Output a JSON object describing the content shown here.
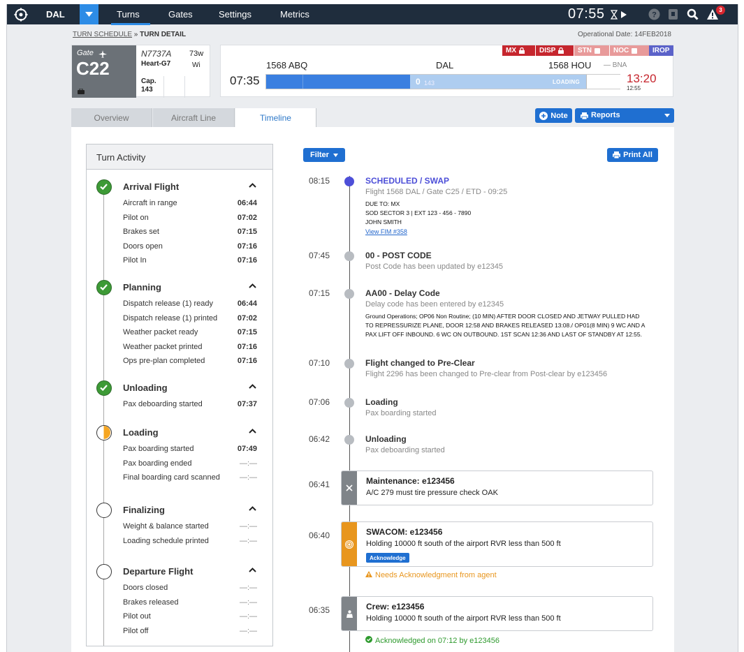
{
  "topbar": {
    "station": "DAL",
    "nav": [
      "Turns",
      "Gates",
      "Settings",
      "Metrics"
    ],
    "clock": "07:55",
    "alert_count": "3"
  },
  "breadcrumb": {
    "parent": "TURN SCHEDULE",
    "separator": " » ",
    "current": "TURN DETAIL"
  },
  "operational_date": "Operational Date: 14FEB2018",
  "gate": {
    "label": "Gate",
    "number": "C22",
    "tail": "N7737A",
    "aircraft": "Heart-G7",
    "code": "73w",
    "wi": "Wi",
    "cap_label": "Cap.",
    "cap_value": "143"
  },
  "flight": {
    "tags": [
      {
        "label": "MX",
        "color": "#c6262e"
      },
      {
        "label": "DISP",
        "color": "#c6262e"
      },
      {
        "label": "STN",
        "color": "#e89a9a"
      },
      {
        "label": "NOC",
        "color": "#e89a9a"
      },
      {
        "label": "IROP",
        "color": "#5b62c9"
      }
    ],
    "arrival": "1568 ABQ",
    "station": "DAL",
    "departure": "1568 HOU",
    "departure_alt": "— BNA",
    "arrival_time": "07:35",
    "departure_time": "13:20",
    "departure_time_small": "12:55",
    "boarded": "0",
    "capacity": "143",
    "status": "LOADING"
  },
  "tabs": [
    {
      "label": "Overview",
      "active": false
    },
    {
      "label": "Aircraft Line",
      "active": false
    },
    {
      "label": "Timeline",
      "active": true
    }
  ],
  "buttons": {
    "note": "Note",
    "reports": "Reports",
    "filter": "Filter",
    "print": "Print All"
  },
  "activity": {
    "title": "Turn Activity",
    "sections": [
      {
        "title": "Arrival Flight",
        "status": "done",
        "items": [
          {
            "label": "Aircraft in range",
            "value": "06:44"
          },
          {
            "label": "Pilot on",
            "value": "07:02"
          },
          {
            "label": "Brakes set",
            "value": "07:15"
          },
          {
            "label": "Doors open",
            "value": "07:16"
          },
          {
            "label": "Pilot In",
            "value": "07:16"
          }
        ]
      },
      {
        "title": "Planning",
        "status": "done",
        "items": [
          {
            "label": "Dispatch release (1) ready",
            "value": "06:44"
          },
          {
            "label": "Dispatch release (1) printed",
            "value": "07:02"
          },
          {
            "label": "Weather packet ready",
            "value": "07:15"
          },
          {
            "label": "Weather packet printed",
            "value": "07:16"
          },
          {
            "label": "Ops pre-plan completed",
            "value": "07:16"
          }
        ]
      },
      {
        "title": "Unloading",
        "status": "done",
        "items": [
          {
            "label": "Pax deboarding started",
            "value": "07:37"
          }
        ]
      },
      {
        "title": "Loading",
        "status": "partial",
        "items": [
          {
            "label": "Pax boarding started",
            "value": "07:49"
          },
          {
            "label": "Pax boarding ended",
            "value": "—:—"
          },
          {
            "label": "Final boarding card scanned",
            "value": "—:—"
          }
        ]
      },
      {
        "title": "Finalizing",
        "status": "pending",
        "items": [
          {
            "label": "Weight & balance started",
            "value": "—:—"
          },
          {
            "label": "Loading schedule printed",
            "value": "—:—"
          }
        ]
      },
      {
        "title": "Departure Flight",
        "status": "pending",
        "items": [
          {
            "label": "Doors closed",
            "value": "—:—"
          },
          {
            "label": "Brakes released",
            "value": "—:—"
          },
          {
            "label": "Pilot out",
            "value": "—:—"
          },
          {
            "label": "Pilot off",
            "value": "—:—"
          }
        ]
      }
    ]
  },
  "timeline": [
    {
      "time": "08:15",
      "title": "SCHEDULED / SWAP",
      "sub": "Flight 1568 DAL / Gate C25 / ETD - 09:25",
      "detail": [
        "DUE TO: MX",
        "SOD SECTOR 3 | EXT 123 - 456 - 7890",
        "JOHN SMITH"
      ],
      "link": "View FIM #358"
    },
    {
      "time": "07:45",
      "title": "00 - POST CODE",
      "sub": "Post Code has been updated by e12345"
    },
    {
      "time": "07:15",
      "title": "AA00 - Delay Code",
      "sub": "Delay code has been entered by e12345",
      "detail": [
        "Ground Operations; OP06 Non Routine; (10 MIN) AFTER DOOR CLOSED AND JETWAY PULLED HAD",
        "TO REPRESSURIZE PLANE, DOOR 12:58 AND BRAKES RELEASED 13:08./ OP01(8 MIN) 9 WC AND A",
        "PAX LIFT OFF INBOUND. 6 WC ON OUTBOUND. 1ST SCAN 12:36 AND LAST OF STANDBY AT 12:55."
      ]
    },
    {
      "time": "07:10",
      "title": "Flight changed to Pre-Clear",
      "sub": "Flight 2296 has been changed to Pre-clear from Post-clear by e123456"
    },
    {
      "time": "07:06",
      "title": "Loading",
      "sub": "Pax boarding started"
    },
    {
      "time": "06:42",
      "title": "Unloading",
      "sub": "Pax deboarding started"
    }
  ],
  "cards": [
    {
      "time": "06:41",
      "title": "Maintenance: e123456",
      "body": "A/C 279 must tire pressure check OAK",
      "icon": "wrench-icon",
      "strip": "#7f8489"
    },
    {
      "time": "06:40",
      "title": "SWACOM: e123456",
      "body": "Holding 10000 ft south of the airport RVR less than 500 ft",
      "icon": "broadcast-icon",
      "strip": "#e8961e",
      "ack_button": "Acknowledge",
      "note": "Needs Acknowledgment from agent",
      "note_color": "#e8961e"
    },
    {
      "time": "06:35",
      "title": "Crew: e123456",
      "body": "Holding 10000 ft south of the airport RVR less than 500 ft",
      "icon": "crew-icon",
      "strip": "#7f8489",
      "note": "Acknowledged on 07:12 by e123456",
      "note_color": "#2e9a2e"
    }
  ]
}
